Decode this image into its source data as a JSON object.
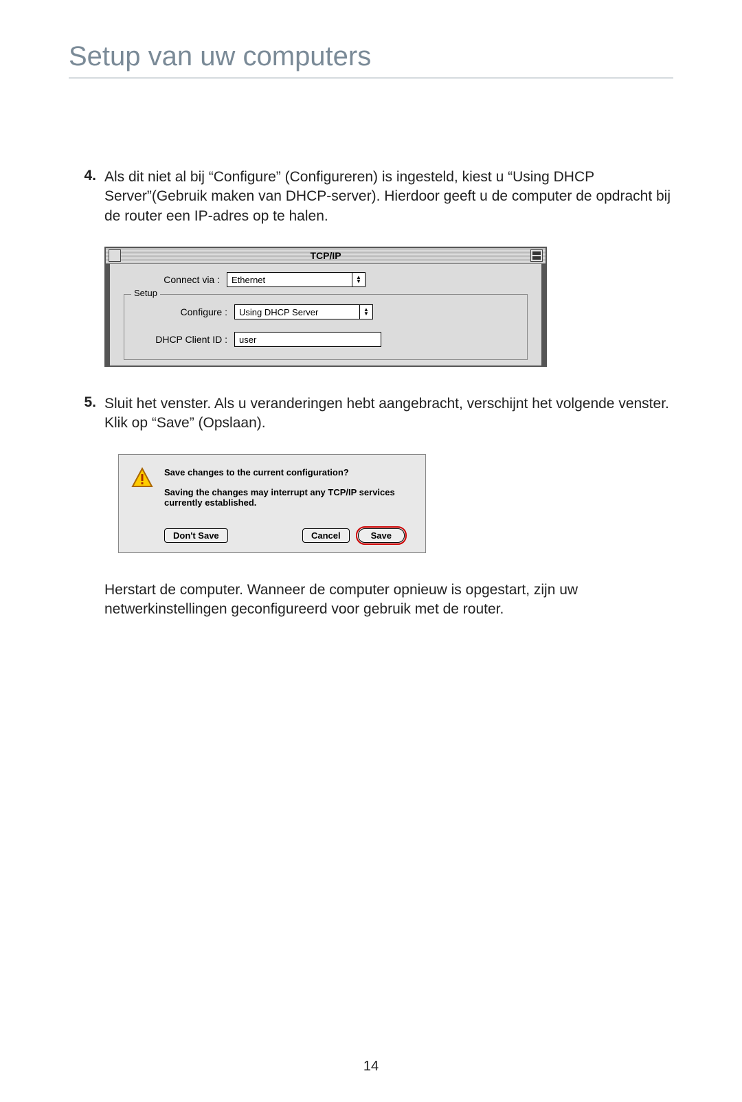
{
  "page": {
    "title": "Setup van uw computers",
    "number": "14"
  },
  "step4": {
    "num": "4.",
    "text": "Als dit niet al bij “Configure” (Configureren) is ingesteld, kiest u “Using DHCP Server”(Gebruik maken van DHCP-server). Hierdoor geeft u de computer de opdracht bij de router een IP-adres op te halen."
  },
  "tcp": {
    "title": "TCP/IP",
    "connect_via_label": "Connect via :",
    "connect_via_value": "Ethernet",
    "setup_label": "Setup",
    "configure_label": "Configure :",
    "configure_value": "Using DHCP Server",
    "dhcp_client_label": "DHCP Client ID :",
    "dhcp_client_value": "user"
  },
  "step5": {
    "num": "5.",
    "text": "Sluit het venster. Als u veranderingen hebt aangebracht, verschijnt het volgende venster. Klik op “Save” (Opslaan)."
  },
  "dialog": {
    "msg1": "Save changes to the current configuration?",
    "msg2": "Saving the changes may interrupt any TCP/IP services currently established.",
    "dont_save": "Don't Save",
    "cancel": "Cancel",
    "save": "Save"
  },
  "after5": {
    "text": "Herstart de computer. Wanneer de computer opnieuw is opgestart, zijn uw netwerkinstellingen geconfigureerd voor gebruik met de router."
  }
}
